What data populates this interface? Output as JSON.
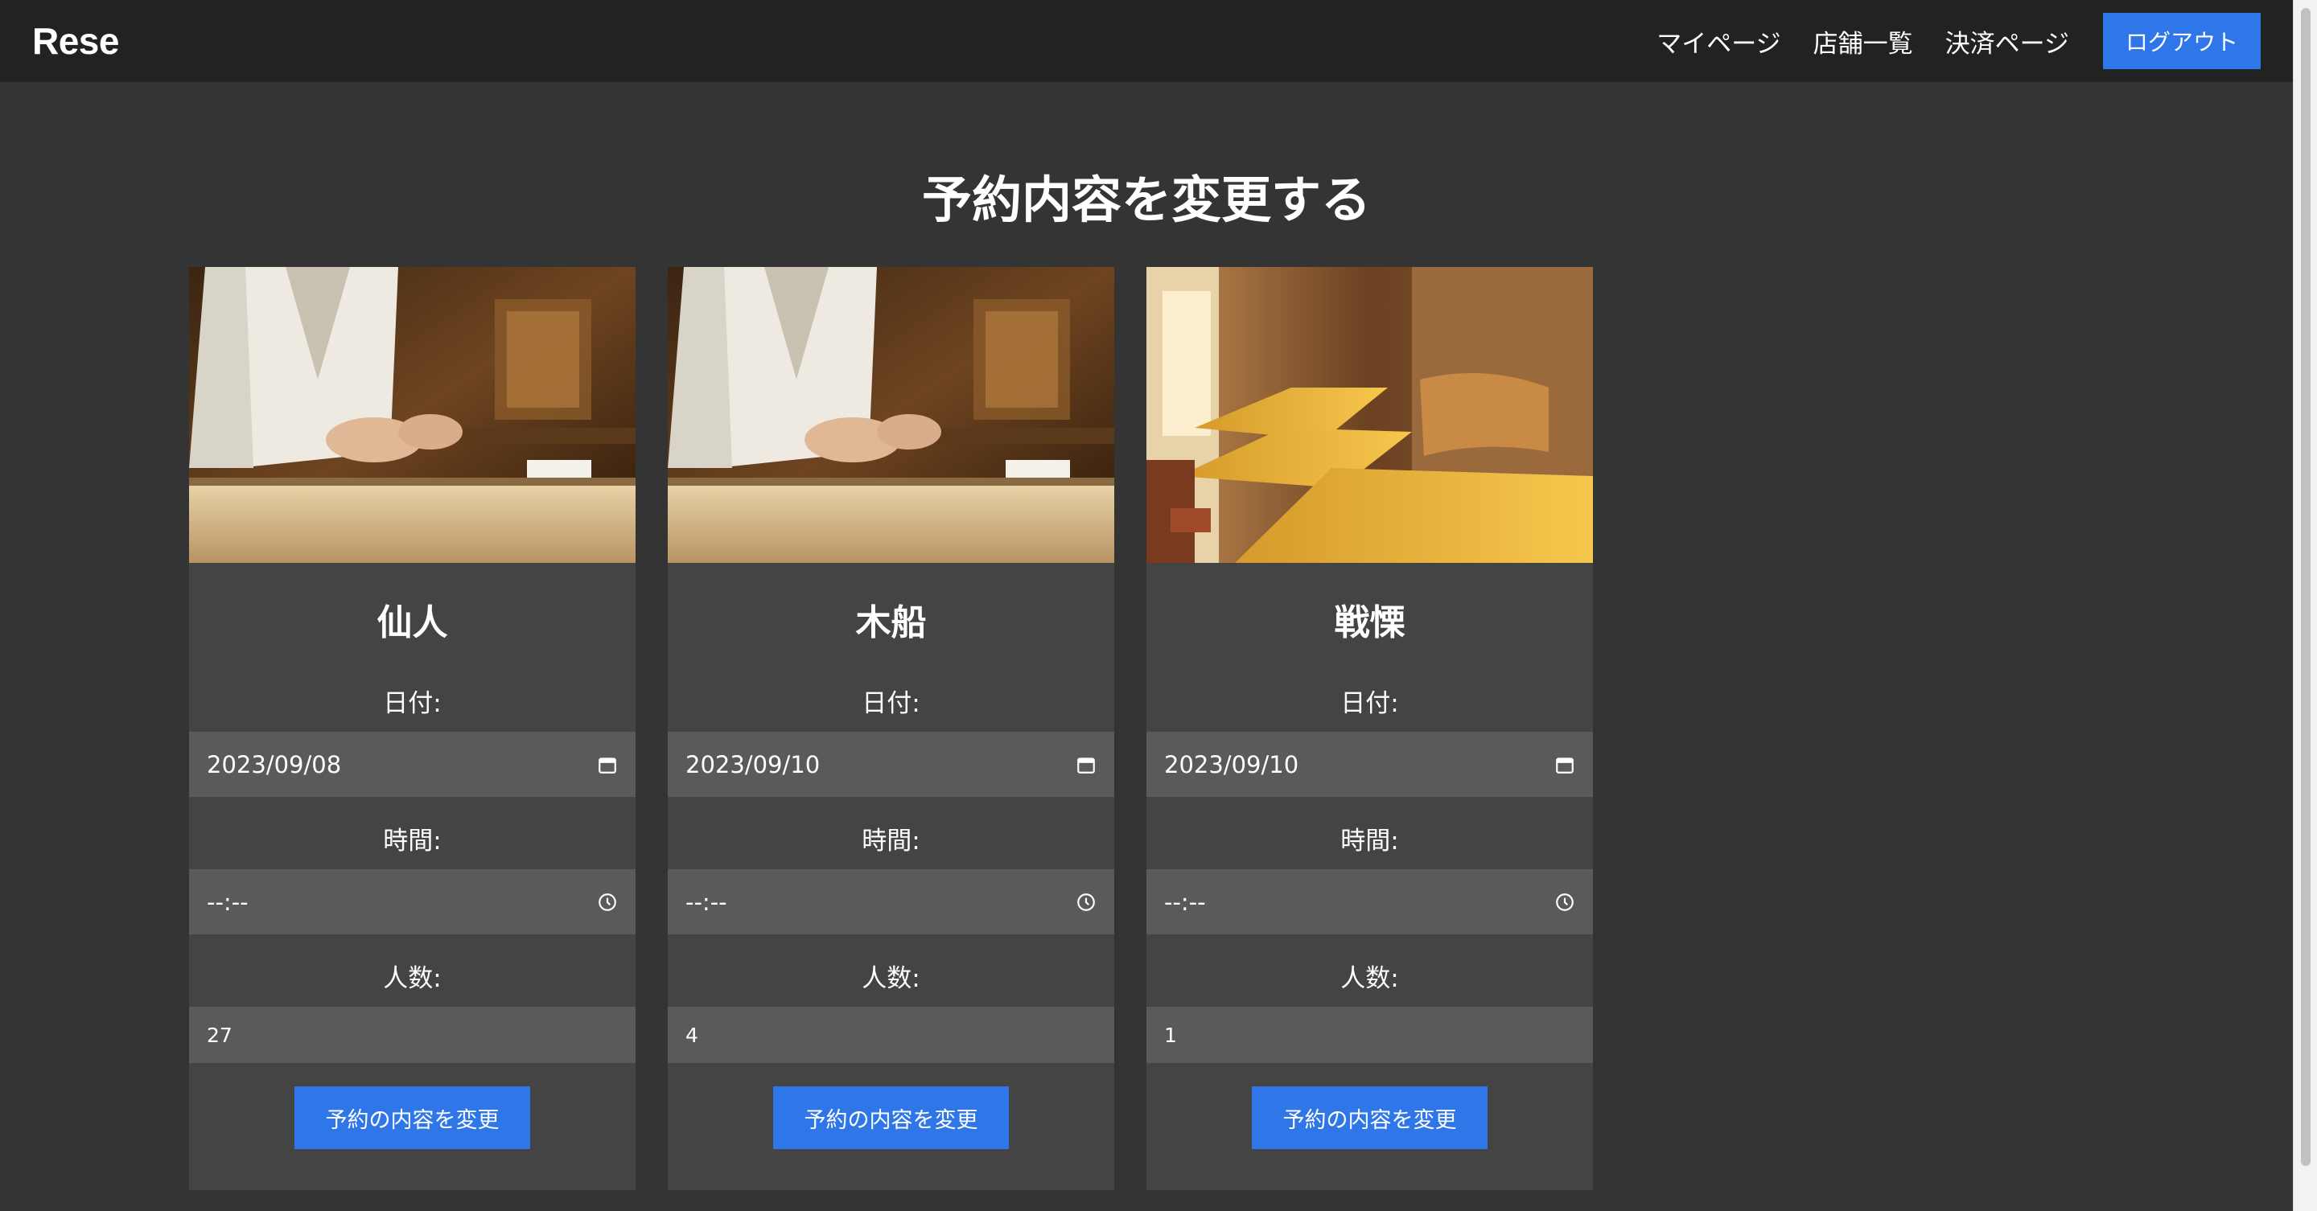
{
  "header": {
    "logo": "Rese",
    "nav": [
      "マイページ",
      "店舗一覧",
      "決済ページ"
    ],
    "logout_label": "ログアウト"
  },
  "page_title": "予約内容を変更する",
  "cards": [
    {
      "name": "仙人",
      "image": "sushi-chef-photo",
      "date_label": "日付:",
      "date_value": "2023/09/08",
      "time_label": "時間:",
      "time_value": "--:--",
      "people_label": "人数:",
      "people_value": "27",
      "button_label": "予約の内容を変更"
    },
    {
      "name": "木船",
      "image": "sushi-chef-photo",
      "date_label": "日付:",
      "date_value": "2023/09/10",
      "time_label": "時間:",
      "time_value": "--:--",
      "people_label": "人数:",
      "people_value": "4",
      "button_label": "予約の内容を変更"
    },
    {
      "name": "戦慄",
      "image": "izakaya-interior-photo",
      "date_label": "日付:",
      "date_value": "2023/09/10",
      "time_label": "時間:",
      "time_value": "--:--",
      "people_label": "人数:",
      "people_value": "1",
      "button_label": "予約の内容を変更"
    }
  ],
  "colors": {
    "header_bg": "#222222",
    "page_bg": "#343434",
    "card_bg": "#444444",
    "field_bg": "#5a5a5a",
    "accent": "#2f76e8"
  }
}
